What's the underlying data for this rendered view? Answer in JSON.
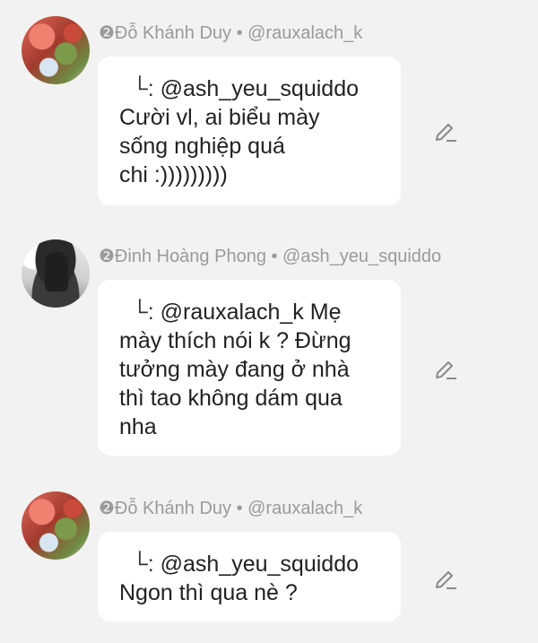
{
  "messages": [
    {
      "author_line": "❷Đỗ Khánh Duy • @rauxalach_k",
      "reply_marker": "└:",
      "lines": [
        "@ash_yeu_squiddo",
        "Cười vl, ai biểu mày",
        "sống nghiệp quá",
        "chi :)))))))))"
      ],
      "icons": {
        "avatar": "avatar-image",
        "edit": "pencil-edit-icon"
      }
    },
    {
      "author_line": "❷Đinh Hoàng Phong • @ash_yeu_squiddo",
      "reply_marker": "└:",
      "lines": [
        "@rauxalach_k Mẹ",
        "mày thích nói k ? Đừng",
        "tưởng mày đang ở nhà",
        "thì tao không dám qua",
        "nha"
      ],
      "icons": {
        "avatar": "avatar-image",
        "edit": "pencil-edit-icon"
      }
    },
    {
      "author_line": "❷Đỗ Khánh Duy • @rauxalach_k",
      "reply_marker": "└:",
      "lines": [
        "@ash_yeu_squiddo",
        "Ngon thì qua nè ?"
      ],
      "icons": {
        "avatar": "avatar-image",
        "edit": "pencil-edit-icon"
      }
    }
  ],
  "colors": {
    "background": "#f2f2f2",
    "bubble": "#ffffff",
    "name_text": "#9a9a9a",
    "message_text": "#222222",
    "icon": "#8a8a8a"
  }
}
